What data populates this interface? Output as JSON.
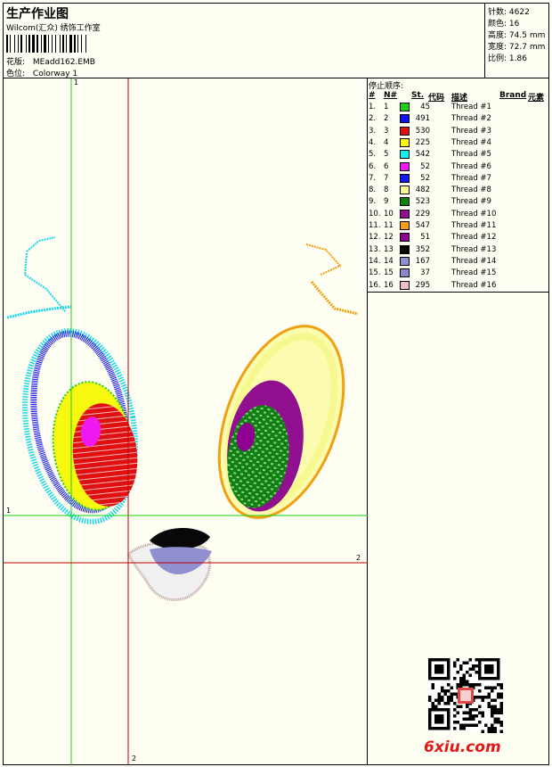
{
  "header": {
    "title": "生产作业图",
    "studio": "Wilcom(汇众) 绣饰工作室",
    "design_label": "花版:",
    "design_name": "MEadd162.EMB",
    "colorway_label": "色位:",
    "colorway_name": "Colorway 1"
  },
  "stats": [
    {
      "label": "针数:",
      "value": "4622"
    },
    {
      "label": "颜色:",
      "value": "16"
    },
    {
      "label": "高度:",
      "value": "74.5 mm"
    },
    {
      "label": "宽度:",
      "value": "72.7 mm"
    },
    {
      "label": "比例:",
      "value": "1.86"
    }
  ],
  "guides": {
    "v1": "1",
    "v2": "2",
    "h1": "1",
    "h2": "2"
  },
  "thread_table": {
    "title": "停止顺序:",
    "headers": {
      "idx": "#",
      "no": "N#",
      "st": "St.",
      "code": "代码",
      "desc": "描述",
      "brand": "Brand",
      "elem": "元素"
    },
    "rows": [
      {
        "idx": "1.",
        "no": "1",
        "color": "#18d018",
        "st": "45",
        "desc": "Thread #1"
      },
      {
        "idx": "2.",
        "no": "2",
        "color": "#1010f0",
        "st": "491",
        "desc": "Thread #2"
      },
      {
        "idx": "3.",
        "no": "3",
        "color": "#e01010",
        "st": "530",
        "desc": "Thread #3"
      },
      {
        "idx": "4.",
        "no": "4",
        "color": "#f8f810",
        "st": "225",
        "desc": "Thread #4"
      },
      {
        "idx": "5.",
        "no": "5",
        "color": "#18f0f0",
        "st": "542",
        "desc": "Thread #5"
      },
      {
        "idx": "6.",
        "no": "6",
        "color": "#f018f0",
        "st": "52",
        "desc": "Thread #6"
      },
      {
        "idx": "7.",
        "no": "7",
        "color": "#1818e8",
        "st": "52",
        "desc": "Thread #7"
      },
      {
        "idx": "8.",
        "no": "8",
        "color": "#f8f890",
        "st": "482",
        "desc": "Thread #8"
      },
      {
        "idx": "9.",
        "no": "9",
        "color": "#108010",
        "st": "523",
        "desc": "Thread #9"
      },
      {
        "idx": "10.",
        "no": "10",
        "color": "#901090",
        "st": "229",
        "desc": "Thread #10"
      },
      {
        "idx": "11.",
        "no": "11",
        "color": "#f0a010",
        "st": "547",
        "desc": "Thread #11"
      },
      {
        "idx": "12.",
        "no": "12",
        "color": "#900090",
        "st": "51",
        "desc": "Thread #12"
      },
      {
        "idx": "13.",
        "no": "13",
        "color": "#080808",
        "st": "352",
        "desc": "Thread #13"
      },
      {
        "idx": "14.",
        "no": "14",
        "color": "#9090d0",
        "st": "167",
        "desc": "Thread #14"
      },
      {
        "idx": "15.",
        "no": "15",
        "color": "#8888c8",
        "st": "37",
        "desc": "Thread #15"
      },
      {
        "idx": "16.",
        "no": "16",
        "color": "#e8c0c0",
        "st": "295",
        "desc": "Thread #16"
      }
    ]
  },
  "watermark": "6xiu.com",
  "colors": {
    "guide_green": "#10d010",
    "guide_red": "#c00000",
    "background": "#fffef2"
  }
}
